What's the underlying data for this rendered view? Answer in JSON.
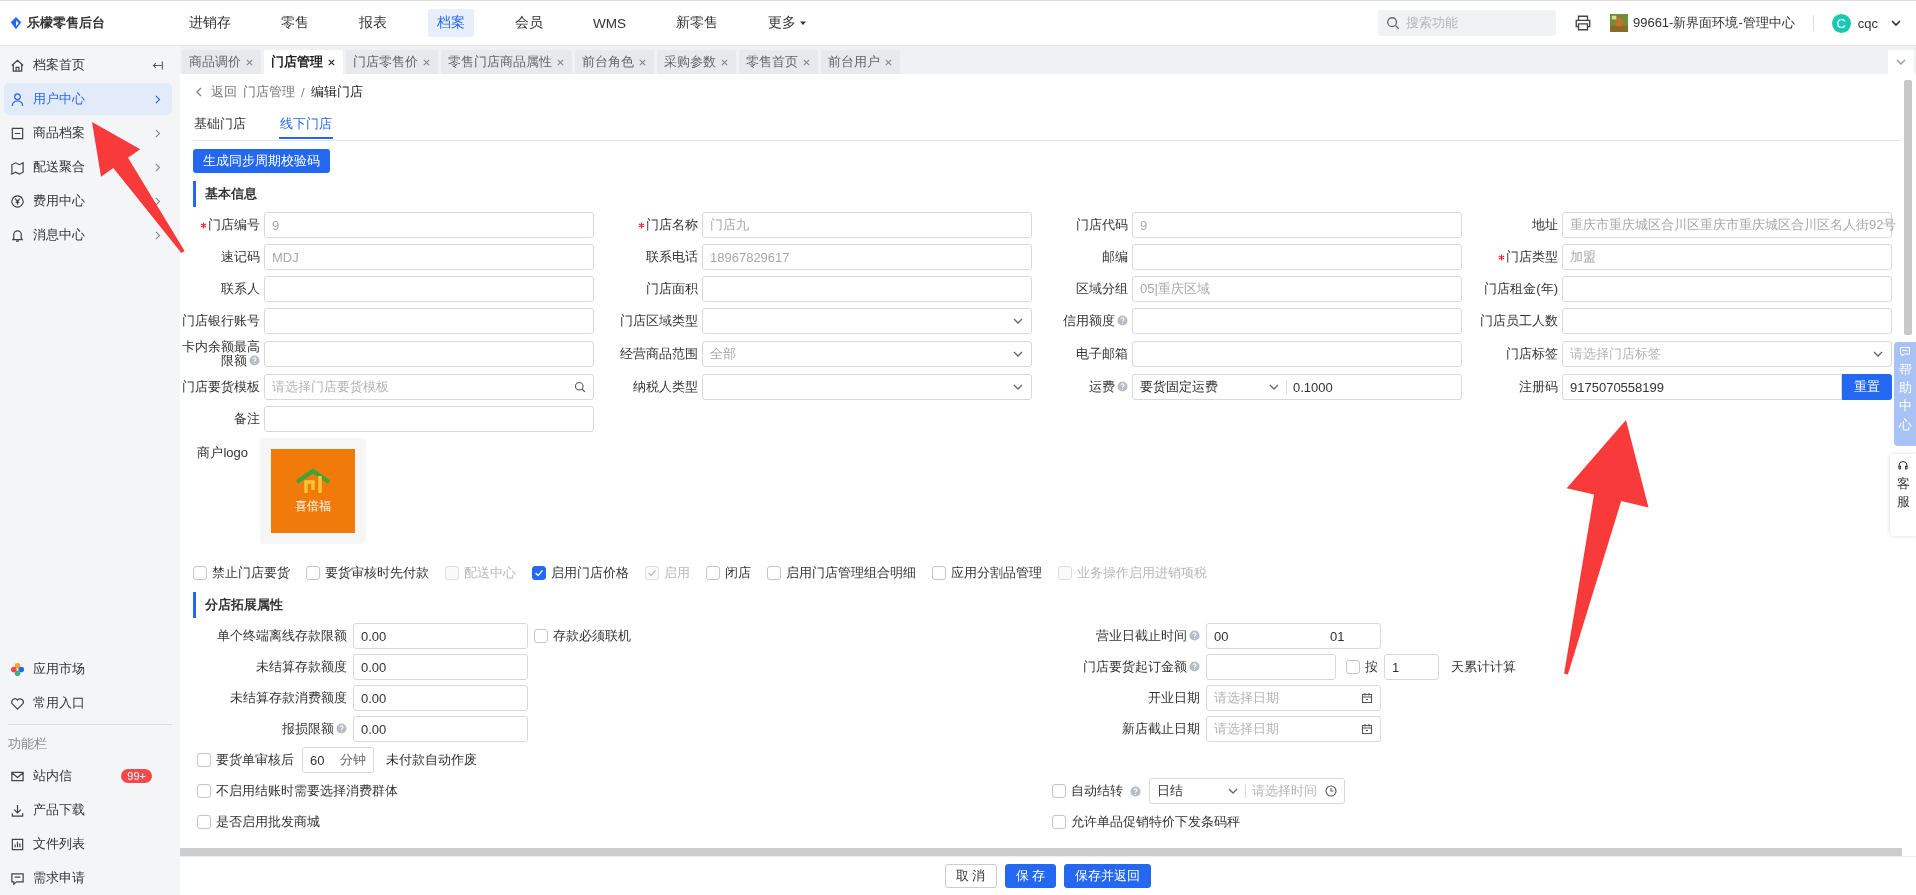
{
  "app": {
    "title": "乐檬零售后台"
  },
  "top_nav": [
    {
      "label": "进销存",
      "selected": false,
      "kind": "link"
    },
    {
      "label": "零售",
      "selected": false,
      "kind": "link"
    },
    {
      "label": "报表",
      "selected": false,
      "kind": "link"
    },
    {
      "label": "档案",
      "selected": true,
      "kind": "link"
    },
    {
      "label": "会员",
      "selected": false,
      "kind": "link"
    },
    {
      "label": "WMS",
      "selected": false,
      "kind": "link"
    },
    {
      "label": "新零售",
      "selected": false,
      "kind": "link"
    },
    {
      "label": "更多",
      "selected": false,
      "kind": "menu"
    }
  ],
  "search": {
    "placeholder": "搜索功能"
  },
  "org": {
    "name": "99661-新界面环境-管理中心"
  },
  "user": {
    "initial": "C",
    "name": "cqc"
  },
  "sidebar": {
    "items": [
      {
        "label": "档案首页",
        "selected": false,
        "kind": "home"
      },
      {
        "label": "用户中心",
        "selected": true,
        "kind": "group"
      },
      {
        "label": "商品档案",
        "selected": false,
        "kind": "group"
      },
      {
        "label": "配送聚合",
        "selected": false,
        "kind": "group"
      },
      {
        "label": "费用中心",
        "selected": false,
        "kind": "group"
      },
      {
        "label": "消息中心",
        "selected": false,
        "kind": "group"
      }
    ],
    "bottom_items": [
      {
        "label": "应用市场"
      },
      {
        "label": "常用入口"
      }
    ],
    "section_label": "功能栏",
    "function_items": [
      {
        "label": "站内信",
        "badge": "99+"
      },
      {
        "label": "产品下载"
      },
      {
        "label": "文件列表"
      },
      {
        "label": "需求申请"
      }
    ]
  },
  "tabs": [
    {
      "label": "商品调价",
      "selected": false
    },
    {
      "label": "门店管理",
      "selected": true
    },
    {
      "label": "门店零售价",
      "selected": false
    },
    {
      "label": "零售门店商品属性",
      "selected": false
    },
    {
      "label": "前台角色",
      "selected": false
    },
    {
      "label": "采购参数",
      "selected": false
    },
    {
      "label": "零售首页",
      "selected": false
    },
    {
      "label": "前台用户",
      "selected": false
    }
  ],
  "breadcrumb": {
    "back": "返回",
    "separator": "/",
    "path": [
      "门店管理",
      "编辑门店"
    ]
  },
  "sub_tabs": [
    {
      "label": "基础门店",
      "selected": false
    },
    {
      "label": "线下门店",
      "selected": true
    }
  ],
  "generate_button": "生成同步周期校验码",
  "basic_info": {
    "title": "基本信息",
    "fields": [
      {
        "label": "门店编号",
        "required": true,
        "kind": "text",
        "value": "9",
        "disabled": true
      },
      {
        "label": "门店名称",
        "required": true,
        "kind": "text",
        "value": "门店九",
        "disabled": true
      },
      {
        "label": "门店代码",
        "kind": "text",
        "value": "9",
        "disabled": true
      },
      {
        "label": "地址",
        "kind": "text",
        "value": "重庆市重庆城区合川区重庆市重庆城区合川区名人街92号",
        "disabled": true
      },
      {
        "label": "速记码",
        "kind": "text",
        "value": "MDJ",
        "disabled": true
      },
      {
        "label": "联系电话",
        "kind": "text",
        "value": "18967829617",
        "disabled": true
      },
      {
        "label": "邮编",
        "kind": "text"
      },
      {
        "label": "门店类型",
        "required": true,
        "kind": "text",
        "value": "加盟",
        "disabled": true
      },
      {
        "label": "联系人",
        "kind": "text"
      },
      {
        "label": "门店面积",
        "kind": "text"
      },
      {
        "label": "区域分组",
        "kind": "text",
        "value": "05|重庆区域",
        "disabled": true
      },
      {
        "label": "门店租金(年)",
        "kind": "text"
      },
      {
        "label": "门店银行账号",
        "kind": "text"
      },
      {
        "label": "门店区域类型",
        "kind": "select"
      },
      {
        "label": "信用额度",
        "help": true,
        "kind": "text"
      },
      {
        "label": "门店员工人数",
        "kind": "text"
      },
      {
        "label": "卡内余额最高限额",
        "help": true,
        "kind": "text"
      },
      {
        "label": "经营商品范围",
        "kind": "select",
        "value": "全部",
        "disabled": true
      },
      {
        "label": "电子邮箱",
        "kind": "text"
      },
      {
        "label": "门店标签",
        "kind": "select",
        "placeholder": "请选择门店标签"
      },
      {
        "label": "门店要货模板",
        "kind": "search",
        "placeholder": "请选择门店要货模板"
      },
      {
        "label": "纳税人类型",
        "kind": "select"
      },
      {
        "label": "运费",
        "help": true,
        "kind": "freight",
        "option": "要货固定运费",
        "value": "0.1000"
      },
      {
        "label": "注册码",
        "kind": "register",
        "value": "9175070558199",
        "action": "重置"
      },
      {
        "label": "备注",
        "kind": "text"
      }
    ],
    "logo": {
      "label": "商户logo",
      "brand": "喜倍福"
    }
  },
  "flags": [
    {
      "label": "禁止门店要货",
      "checked": false,
      "disabled": false
    },
    {
      "label": "要货审核时先付款",
      "checked": false,
      "disabled": false
    },
    {
      "label": "配送中心",
      "checked": false,
      "disabled": true
    },
    {
      "label": "启用门店价格",
      "checked": true,
      "disabled": false
    },
    {
      "label": "启用",
      "checked": true,
      "disabled": true
    },
    {
      "label": "闭店",
      "checked": false,
      "disabled": false
    },
    {
      "label": "启用门店管理组合明细",
      "checked": false,
      "disabled": false
    },
    {
      "label": "应用分割品管理",
      "checked": false,
      "disabled": false
    },
    {
      "label": "业务操作启用进销项税",
      "checked": false,
      "disabled": true
    }
  ],
  "ext": {
    "title": "分店拓展属性",
    "left": [
      {
        "label": "单个终端离线存款限额",
        "value": "0.00",
        "extra": {
          "label": "存款必须联机",
          "checked": false
        }
      },
      {
        "label": "未结算存款额度",
        "value": "0.00"
      },
      {
        "label": "未结算存款消费额度",
        "value": "0.00"
      },
      {
        "label": "报损限额",
        "help": true,
        "value": "0.00"
      }
    ],
    "right": [
      {
        "label": "营业日截止时间",
        "help": true,
        "kind": "timerange",
        "start": "00",
        "end": "01"
      },
      {
        "label": "门店要货起订金额",
        "help": true,
        "kind": "amount",
        "check_label": "按",
        "checked": false,
        "days": "1",
        "suffix": "天累计计算"
      },
      {
        "label": "开业日期",
        "kind": "date",
        "placeholder": "请选择日期"
      },
      {
        "label": "新店截止日期",
        "kind": "date",
        "placeholder": "请选择日期"
      }
    ]
  },
  "options": [
    {
      "left": {
        "kind": "audit",
        "label": "要货单审核后",
        "checked": false,
        "value": "60",
        "unit": "分钟",
        "suffix": "未付款自动作废"
      }
    },
    {
      "left": {
        "kind": "check",
        "label": "不启用结账时需要选择消费群体",
        "checked": false
      },
      "right": {
        "kind": "auto",
        "label": "自动结转",
        "help": true,
        "checked": false,
        "option": "日结",
        "placeholder": "请选择时间"
      }
    },
    {
      "left": {
        "kind": "check",
        "label": "是否启用批发商城",
        "checked": false
      },
      "right": {
        "kind": "check",
        "label": "允许单品促销特价下发条码秤",
        "checked": false
      }
    }
  ],
  "footer": {
    "buttons": [
      {
        "label": "取 消",
        "kind": "default"
      },
      {
        "label": "保 存",
        "kind": "primary"
      },
      {
        "label": "保存并返回",
        "kind": "primary"
      }
    ]
  },
  "float_help": {
    "label": "帮助中心"
  },
  "float_service": {
    "label": "客服"
  },
  "annotation_arrows": [
    {
      "kind": "arrow"
    },
    {
      "kind": "arrow"
    }
  ]
}
